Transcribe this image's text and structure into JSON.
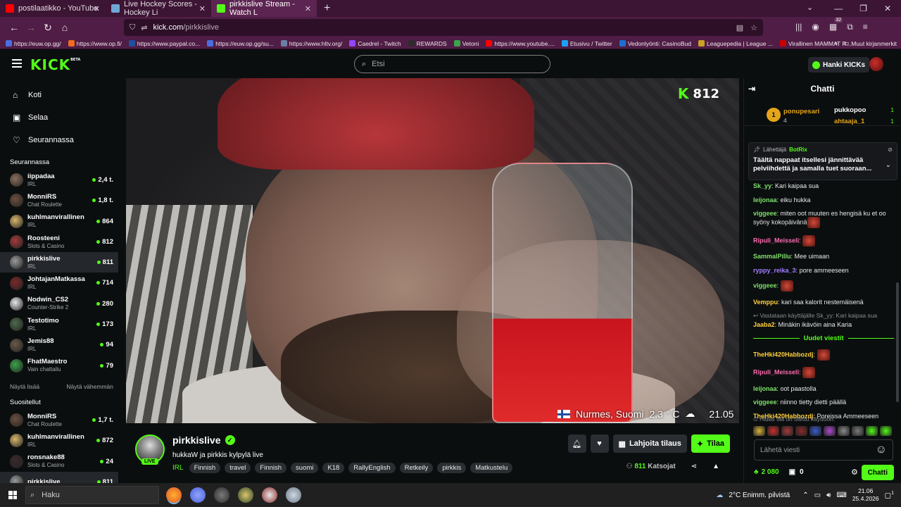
{
  "browser": {
    "tabs": [
      {
        "title": "postilaatikko - YouTube",
        "color": "#ff0000"
      },
      {
        "title": "Live Hockey Scores - Hockey Li",
        "color": "#6ea7d6"
      },
      {
        "title": "pirkkislive Stream - Watch L",
        "color": "#53fc18",
        "active": true
      }
    ],
    "new_tab": "+",
    "url_domain": "kick.com",
    "url_path": "/pirkkislive",
    "ext_badge": "32",
    "bookmarks": [
      {
        "label": "https://euw.op.gg/",
        "color": "#4a6ee0"
      },
      {
        "label": "https://www.op.fi/",
        "color": "#f26b1d"
      },
      {
        "label": "https://www.paypal.co...",
        "color": "#1f4fa0"
      },
      {
        "label": "https://euw.op.gg/su...",
        "color": "#4a6ee0"
      },
      {
        "label": "https://www.hltv.org/",
        "color": "#6b7fa3"
      },
      {
        "label": "Caedrel - Twitch",
        "color": "#9146ff"
      },
      {
        "label": "REWARDS",
        "color": "#2c2c2c"
      },
      {
        "label": "Vetoni",
        "color": "#3aa34a"
      },
      {
        "label": "https://www.youtube....",
        "color": "#ff0000"
      },
      {
        "label": "Etusivu / Twitter",
        "color": "#1da1f2"
      },
      {
        "label": "Vedonlyönti: CasinoBud",
        "color": "#1f6fd1"
      },
      {
        "label": "Leaguepedia | League ...",
        "color": "#c9a227"
      },
      {
        "label": "Virallinen MAMMAT R...",
        "color": "#cc0000"
      }
    ],
    "other_bookmarks": "Muut kirjanmerkit"
  },
  "kick": {
    "logo": "KICK",
    "logo_beta": "BETA",
    "search_placeholder": "Etsi",
    "get_kicks": "Hanki KICKs"
  },
  "sidebar": {
    "nav": [
      {
        "label": "Koti",
        "icon": "home-icon",
        "glyph": "⌂"
      },
      {
        "label": "Selaa",
        "icon": "browse-icon",
        "glyph": "▣"
      },
      {
        "label": "Seurannassa",
        "icon": "heart-icon",
        "glyph": "♡"
      }
    ],
    "following_title": "Seurannassa",
    "following": [
      {
        "name": "iippadaa",
        "category": "IRL",
        "viewers": "2,4 t.",
        "color": "#8a6f5c"
      },
      {
        "name": "MonniRS",
        "category": "Chat Roulette",
        "viewers": "1,8 t.",
        "color": "#6b4e3d"
      },
      {
        "name": "kuhlmanvirallinen",
        "category": "IRL",
        "viewers": "864",
        "color": "#d8b56a"
      },
      {
        "name": "Roosteeni",
        "category": "Slots & Casino",
        "viewers": "812",
        "color": "#a33a3a"
      },
      {
        "name": "pirkkislive",
        "category": "IRL",
        "viewers": "811",
        "color": "#9a9a9a",
        "active": true
      },
      {
        "name": "JohtajanMatkassa",
        "category": "IRL",
        "viewers": "714",
        "color": "#7a2a2a"
      },
      {
        "name": "Nodwin_CS2",
        "category": "Counter-Strike 2",
        "viewers": "280",
        "color": "#e8e8e8"
      },
      {
        "name": "Testotimo",
        "category": "IRL",
        "viewers": "173",
        "color": "#4d6b4a"
      },
      {
        "name": "Jemis88",
        "category": "IRL",
        "viewers": "94",
        "color": "#6a5a4a"
      },
      {
        "name": "FhatMaestro",
        "category": "Vain chattailu",
        "viewers": "79",
        "color": "#3aa34a"
      }
    ],
    "show_more": "Näytä lisää",
    "show_less": "Näytä vähemmän",
    "recommended_title": "Suositellut",
    "recommended": [
      {
        "name": "MonniRS",
        "category": "Chat Roulette",
        "viewers": "1,7 t.",
        "color": "#6b4e3d"
      },
      {
        "name": "kuhlmanvirallinen",
        "category": "IRL",
        "viewers": "872",
        "color": "#d8b56a"
      },
      {
        "name": "ronsnake88",
        "category": "Slots & Casino",
        "viewers": "24",
        "color": "#3a2a2a"
      },
      {
        "name": "pirkkislive",
        "category": "",
        "viewers": "811",
        "color": "#9a9a9a",
        "active": true
      }
    ]
  },
  "video": {
    "viewer_count": "812",
    "location": "Nurmes, Suomi",
    "temperature": "2.3 ° C",
    "time": "21.05"
  },
  "stream": {
    "streamer": "pirkkislive",
    "live": "LIVE",
    "title": "hukkaW ja pirkkis kylpylä live",
    "category": "IRL",
    "tags": [
      "Finnish",
      "travel",
      "Finnish",
      "suomi",
      "K18",
      "RallyEnglish",
      "Retkeily",
      "pirkkis",
      "Matkustelu"
    ],
    "gift_label": "Lahjoita tilaus",
    "subscribe_label": "Tilaa",
    "viewers": "811",
    "viewers_label": "Katsojat"
  },
  "chat": {
    "title": "Chatti",
    "leaderboard": [
      {
        "rank": "1",
        "name": "ponupesari",
        "count": "4"
      },
      {
        "name": "pukkopoo",
        "count": "1"
      },
      {
        "name": "ahtaaja_1",
        "count": "1"
      }
    ],
    "pinned_by": "Lähettäjä",
    "pinned_bot": "BotRix",
    "pinned_text": "Täältä nappaat itsellesi jännittävää pelviihdettä ja samalla tuet suoraan...",
    "messages": [
      {
        "user": "Sk_yy",
        "text": "Kari kaipaa sua",
        "color": "#7ee06a"
      },
      {
        "user": "leijonaa",
        "text": "eiku hukka",
        "color": "#7ee06a"
      },
      {
        "user": "viggeee",
        "text": "miten oot muuten es hengisä ku et oo syöny kokopäivänä",
        "color": "#7ee06a",
        "emote": true
      },
      {
        "user": "Ripuli_Meisseli",
        "text": "",
        "color": "#ff6bb0",
        "emote": true
      },
      {
        "user": "SammalPillu",
        "text": "Mee uimaan",
        "color": "#7ee06a"
      },
      {
        "user": "ryppy_reika_3",
        "text": "pore ammeeseen",
        "color": "#a57cff"
      },
      {
        "user": "viggeee",
        "text": "",
        "color": "#7ee06a",
        "emote": true
      },
      {
        "user": "Vemppu",
        "text": "kari saa kalorit nestemäisenä",
        "color": "#ffd23a"
      }
    ],
    "reply_note": "Vastataan käyttäjälle Sk_yy: Kari kaipaa sua",
    "reply_msg": {
      "user": "Jaaba2",
      "text": "Minäkin ikävöin aina Karia",
      "color": "#ffd23a"
    },
    "new_messages": "Uudet viestit",
    "new": [
      {
        "user": "TheHki420Habbozdj",
        "text": "",
        "color": "#ffd23a",
        "emote": true
      },
      {
        "user": "Ripuli_Meisseli",
        "text": "",
        "color": "#ff6bb0",
        "emote": true
      },
      {
        "user": "leijonaa",
        "text": "oot paastolla",
        "color": "#7ee06a"
      },
      {
        "user": "viggeee",
        "text": "niinno tietty dietti päällä",
        "color": "#7ee06a"
      },
      {
        "user": "TheHki420Habbozdj",
        "text": "Poreissa Ammeeseen",
        "color": "#ffd23a"
      }
    ],
    "slow_mode": "Hidas tila on otettu käyttöön.",
    "input_placeholder": "Lähetä viesti",
    "kicks_balance": "2 080",
    "gifts": "0",
    "send_label": "Chatti"
  },
  "taskbar": {
    "search": "Haku",
    "weather": "2°C  Enimm. pilvistä",
    "time": "21.06",
    "date": "25.4.2026",
    "notifications": "1"
  }
}
